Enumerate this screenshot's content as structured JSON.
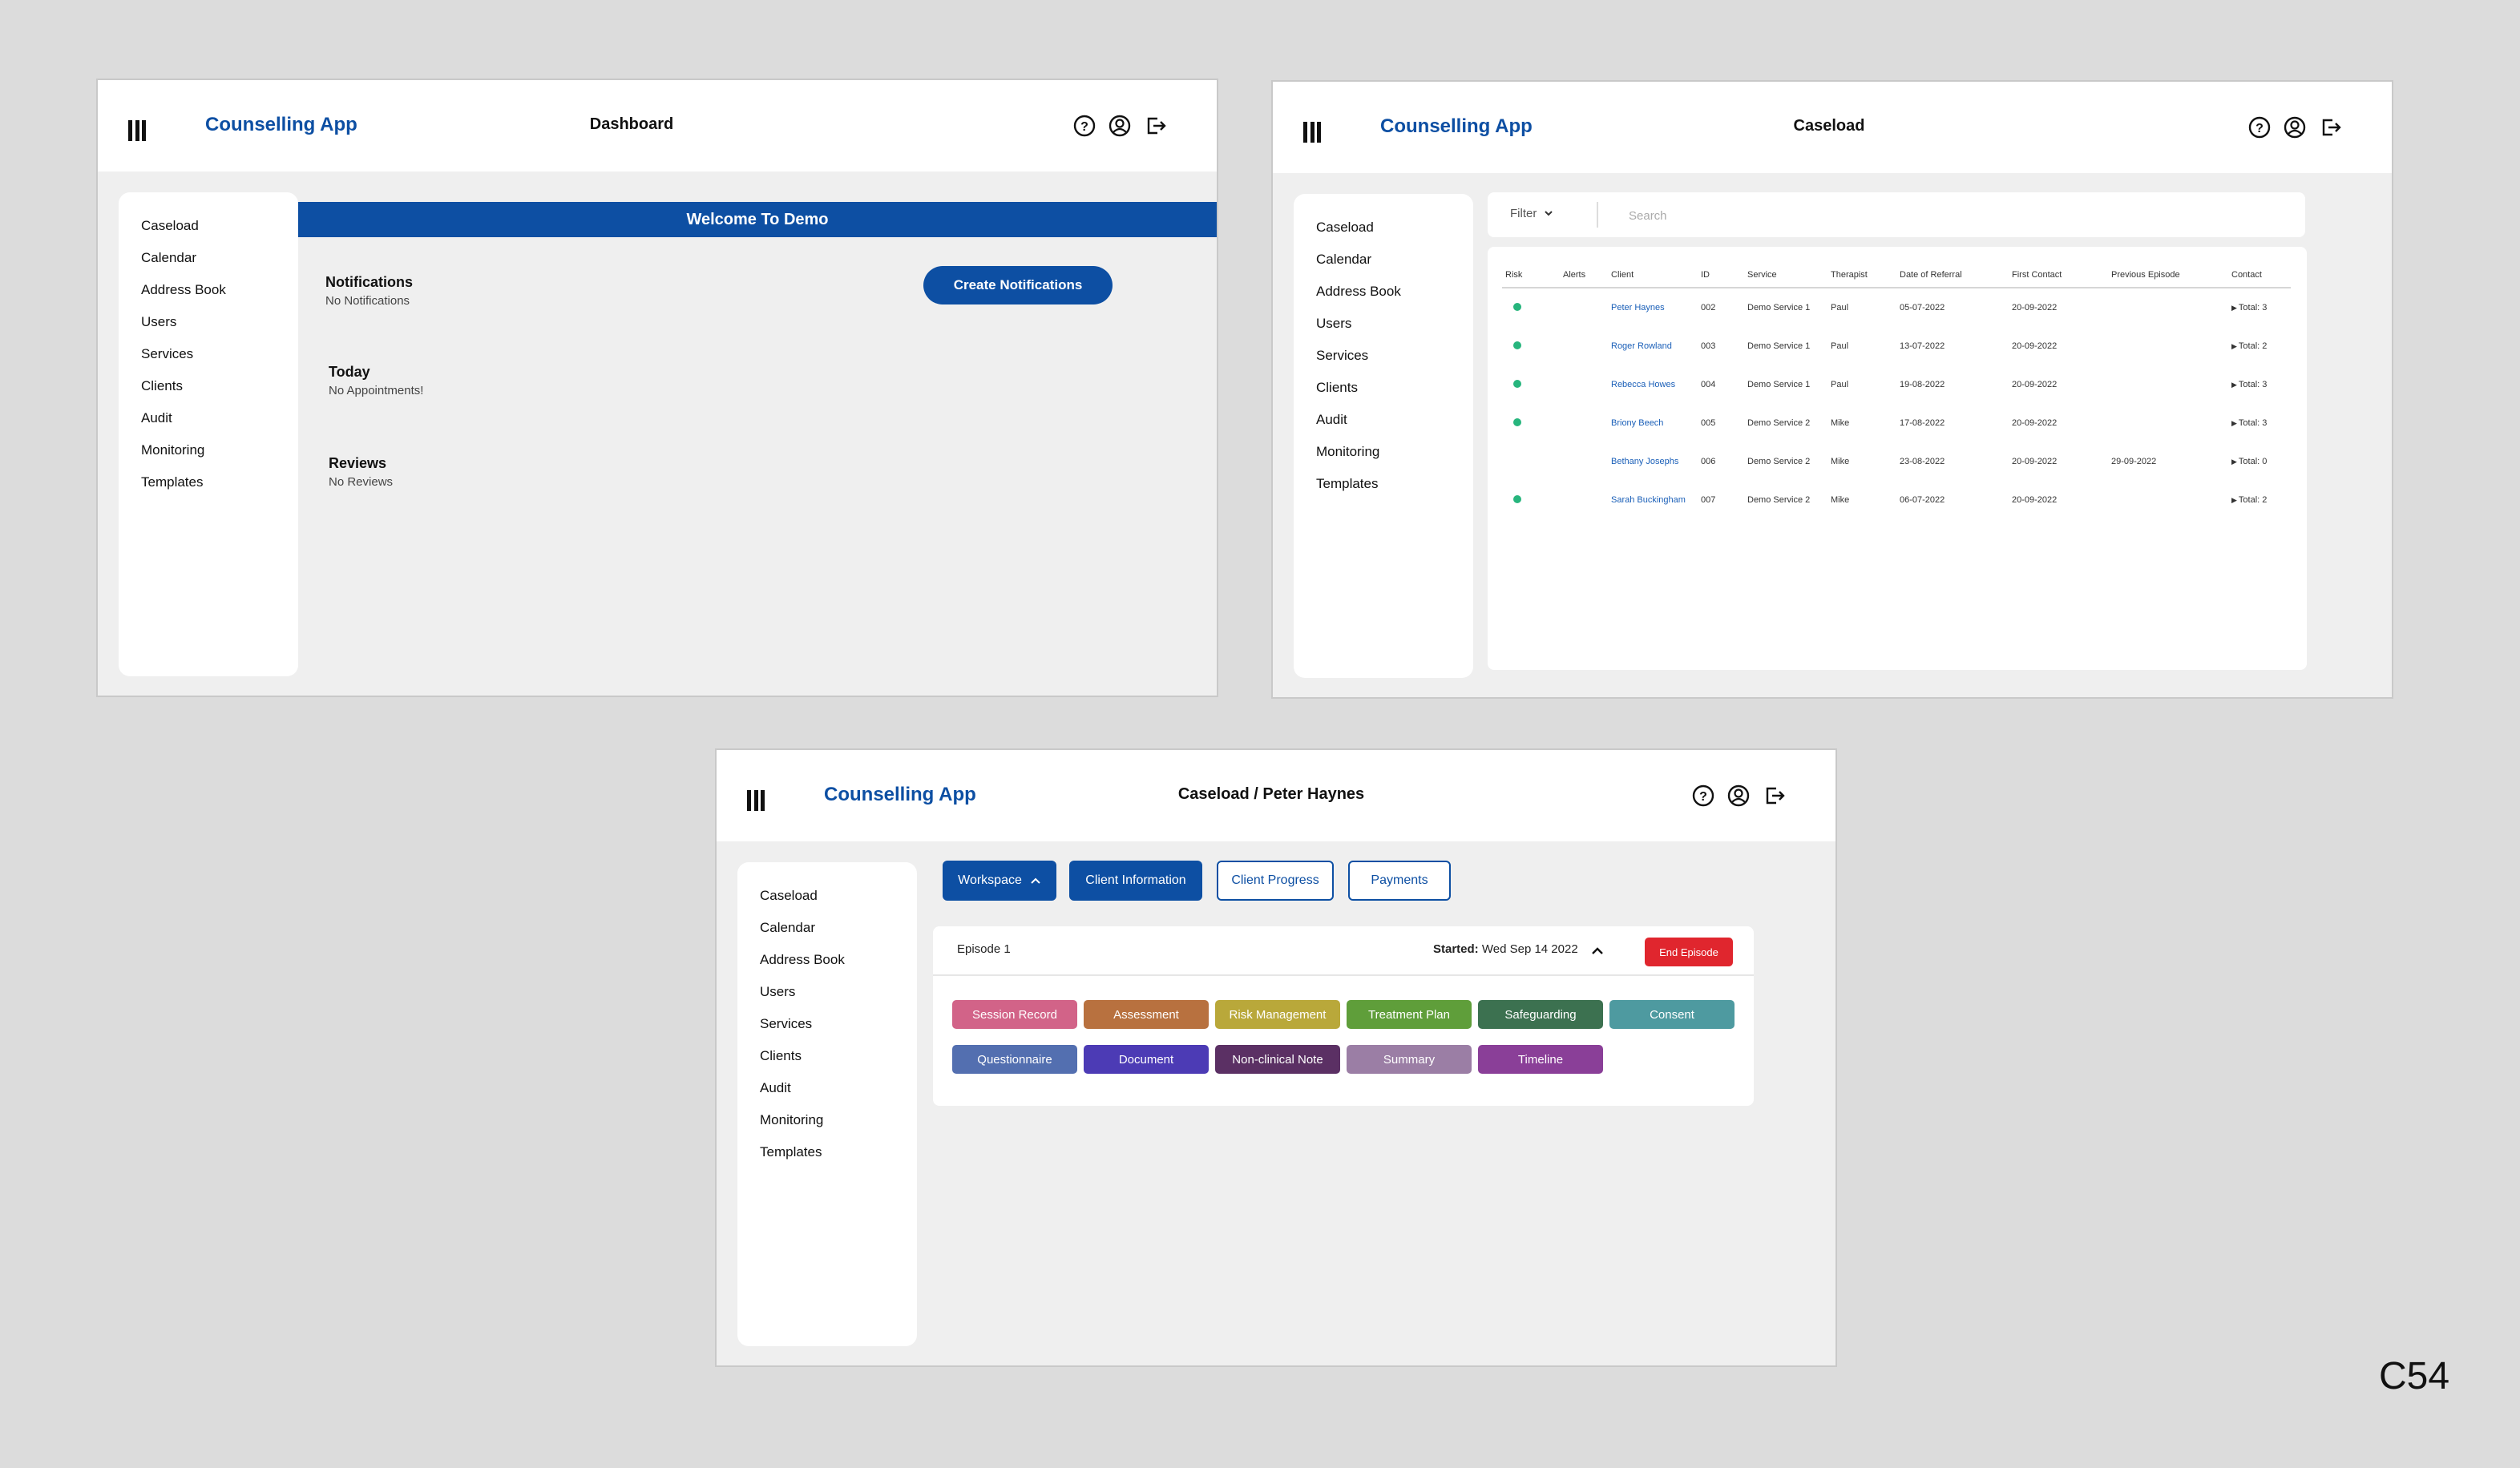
{
  "app": {
    "brand": "Counselling App"
  },
  "nav": [
    "Caseload",
    "Calendar",
    "Address Book",
    "Users",
    "Services",
    "Clients",
    "Audit",
    "Monitoring",
    "Templates"
  ],
  "icons": {
    "menu": "menu-bars-icon",
    "help": "help-icon",
    "account": "user-account-icon",
    "logout": "logout-icon"
  },
  "colors": {
    "brand": "#0d4fa3",
    "end_episode": "#e0262e",
    "risk": "#27b57d"
  },
  "dashboard": {
    "title": "Dashboard",
    "welcome": "Welcome To Demo",
    "notifications": {
      "heading": "Notifications",
      "text": "No Notifications"
    },
    "today": {
      "heading": "Today",
      "text": "No Appointments!"
    },
    "reviews": {
      "heading": "Reviews",
      "text": "No Reviews"
    },
    "create_button": "Create Notifications"
  },
  "caseload": {
    "title": "Caseload",
    "filter_label": "Filter",
    "search_placeholder": "Search",
    "columns": [
      "Risk",
      "Alerts",
      "Client",
      "ID",
      "Service",
      "Therapist",
      "Date of Referral",
      "First Contact",
      "Previous Episode",
      "Contact"
    ],
    "rows": [
      {
        "risk": true,
        "alerts": "",
        "client": "Peter Haynes",
        "id": "002",
        "service": "Demo Service 1",
        "therapist": "Paul",
        "referral": "05-07-2022",
        "first_contact": "20-09-2022",
        "previous": "",
        "contact": "Total: 3"
      },
      {
        "risk": true,
        "alerts": "",
        "client": "Roger Rowland",
        "id": "003",
        "service": "Demo Service 1",
        "therapist": "Paul",
        "referral": "13-07-2022",
        "first_contact": "20-09-2022",
        "previous": "",
        "contact": "Total: 2"
      },
      {
        "risk": true,
        "alerts": "",
        "client": "Rebecca Howes",
        "id": "004",
        "service": "Demo Service 1",
        "therapist": "Paul",
        "referral": "19-08-2022",
        "first_contact": "20-09-2022",
        "previous": "",
        "contact": "Total: 3"
      },
      {
        "risk": true,
        "alerts": "",
        "client": "Briony Beech",
        "id": "005",
        "service": "Demo Service 2",
        "therapist": "Mike",
        "referral": "17-08-2022",
        "first_contact": "20-09-2022",
        "previous": "",
        "contact": "Total: 3"
      },
      {
        "risk": false,
        "alerts": "",
        "client": "Bethany Josephs",
        "id": "006",
        "service": "Demo Service 2",
        "therapist": "Mike",
        "referral": "23-08-2022",
        "first_contact": "20-09-2022",
        "previous": "29-09-2022",
        "contact": "Total: 0"
      },
      {
        "risk": true,
        "alerts": "",
        "client": "Sarah Buckingham",
        "id": "007",
        "service": "Demo Service 2",
        "therapist": "Mike",
        "referral": "06-07-2022",
        "first_contact": "20-09-2022",
        "previous": "",
        "contact": "Total: 2"
      }
    ]
  },
  "client_view": {
    "title": "Caseload / Peter Haynes",
    "tabs": [
      "Workspace",
      "Client Information",
      "Client Progress",
      "Payments"
    ],
    "episode": {
      "label": "Episode 1",
      "started_label": "Started:",
      "started_value": "Wed Sep 14 2022",
      "end_button": "End Episode"
    },
    "tools": [
      {
        "label": "Session Record",
        "color": "#d26388"
      },
      {
        "label": "Assessment",
        "color": "#b8713f"
      },
      {
        "label": "Risk Management",
        "color": "#b9a83a"
      },
      {
        "label": "Treatment Plan",
        "color": "#5f9e3a"
      },
      {
        "label": "Safeguarding",
        "color": "#3c7150"
      },
      {
        "label": "Consent",
        "color": "#4e9aa0"
      },
      {
        "label": "Questionnaire",
        "color": "#536fb0"
      },
      {
        "label": "Document",
        "color": "#4c3bb5"
      },
      {
        "label": "Non-clinical Note",
        "color": "#5b3064"
      },
      {
        "label": "Summary",
        "color": "#9b7ea5"
      },
      {
        "label": "Timeline",
        "color": "#8a3f98"
      }
    ]
  },
  "corner_label": "C54"
}
